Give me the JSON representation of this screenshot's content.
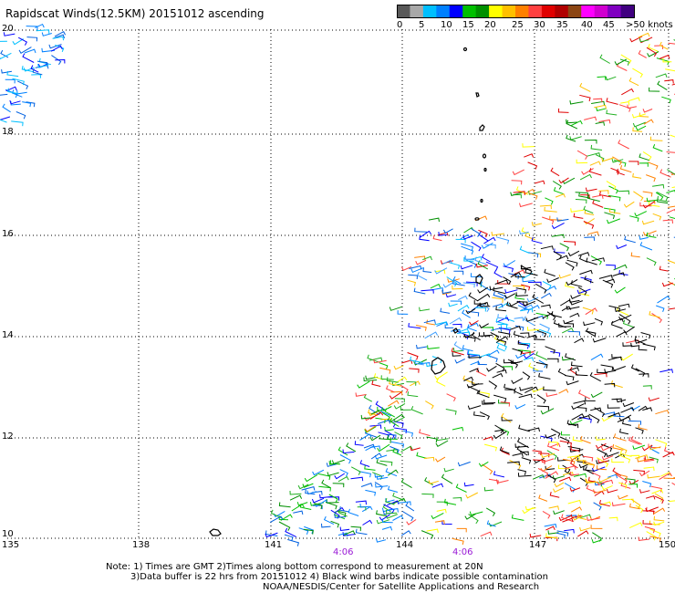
{
  "title": "Rapidscat Winds(12.5KM) 20151012 ascending",
  "colorbar": {
    "colors": [
      "#585858",
      "#a8a8a8",
      "#00bfff",
      "#0080ff",
      "#0000ff",
      "#00c000",
      "#009000",
      "#ffff00",
      "#ffc000",
      "#ff8000",
      "#ff4040",
      "#e00000",
      "#b00000",
      "#8b4513",
      "#ff00ff",
      "#d000d0",
      "#8000c0",
      "#400080"
    ],
    "ticks": [
      "0",
      "5",
      "10",
      "15",
      "20",
      "25",
      "30",
      "35",
      "40",
      "45",
      ">50 knots"
    ]
  },
  "axes": {
    "lat_labels": [
      "20",
      "18",
      "16",
      "14",
      "12",
      "10"
    ],
    "lon_labels": [
      "135",
      "138",
      "141",
      "144",
      "147",
      "150"
    ],
    "time_labels": [
      "4:06",
      "4:06"
    ]
  },
  "notes": {
    "line1": "Note: 1) Times are GMT 2)Times along bottom correspond to measurement at 20N",
    "line2": "3)Data buffer is 22 hrs from 20151012 4) Black wind barbs indicate possible contamination",
    "line3": "NOAA/NESDIS/Center for Satellite Applications and Research"
  },
  "legend_colors": {
    "time_label": "#9a1ad6",
    "contamination": "#000000"
  }
}
